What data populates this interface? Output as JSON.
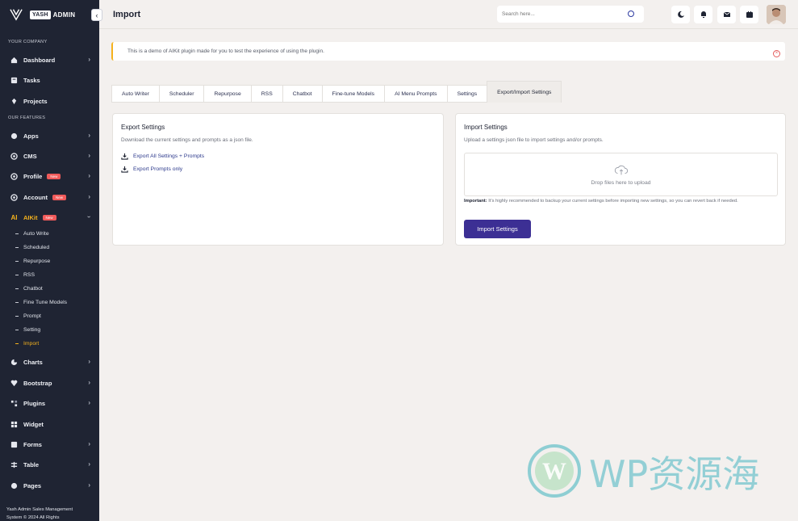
{
  "sidebar": {
    "brand_badge": "YASH",
    "brand_name": "ADMIN",
    "section_company": "YOUR COMPANY",
    "section_features": "OUR FEATURES",
    "items": {
      "dashboard": "Dashboard",
      "tasks": "Tasks",
      "projects": "Projects",
      "apps": "Apps",
      "cms": "CMS",
      "profile": "Profile",
      "account": "Account",
      "aikit": "AIKit",
      "charts": "Charts",
      "bootstrap": "Bootstrap",
      "plugins": "Plugins",
      "widget": "Widget",
      "forms": "Forms",
      "table": "Table",
      "pages": "Pages"
    },
    "badge_new": "New",
    "aikit_subitems": [
      "Auto Write",
      "Scheduled",
      "Repurpose",
      "RSS",
      "Chatbot",
      "Fine Tune Models",
      "Prompt",
      "Setting",
      "Import"
    ],
    "footer_line1": "Yash Admin Sales Management",
    "footer_line2": "System © 2024 All Rights",
    "accent_color": "#f5b21d"
  },
  "header": {
    "title": "Import",
    "search_placeholder": "Search here..."
  },
  "notice": {
    "text": "This is a demo of AIKit plugin made for you to test the experience of using the plugin."
  },
  "tabs": [
    "Auto Writer",
    "Scheduler",
    "Repurpose",
    "RSS",
    "Chatbot",
    "Fine-tune Models",
    "AI Menu Prompts",
    "Settings",
    "Export/Import Settings"
  ],
  "active_tab": "Export/Import Settings",
  "export": {
    "title": "Export Settings",
    "description": "Download the current settings and prompts as a json file.",
    "link_all": "Export All Settings + Prompts",
    "link_prompts": "Export Prompts only"
  },
  "import": {
    "title": "Import Settings",
    "description": "Upload a settings json file to import settings and/or prompts.",
    "drop_text": "Drop files here to upload",
    "important_label": "Important:",
    "important_text": " It's highly recommended to backup your current settings before importing new settings, so you can revert back if needed.",
    "button_label": "Import Settings",
    "button_color": "#3c2f94"
  },
  "watermark": {
    "text": "WP资源海"
  }
}
